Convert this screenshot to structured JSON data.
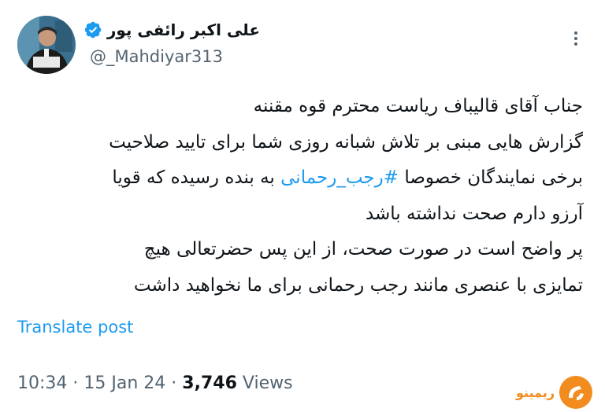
{
  "author": {
    "name": "علی اکبر رائفی پور",
    "handle": "@_Mahdiyar313"
  },
  "post": {
    "lines": [
      {
        "text": "جناب آقای قالیباف ریاست محترم قوه مقننه"
      },
      {
        "text": "گزارش هایی مبنی بر تلاش شبانه روزی شما برای تایید صلاحیت"
      },
      {
        "before": "برخی نمایندگان خصوصا ",
        "hashtag": "#رجب_رحمانی",
        "after": " به بنده رسیده که قویا"
      },
      {
        "text": "آرزو دارم صحت نداشته باشد"
      },
      {
        "text": "پر واضح است در صورت صحت، از این پس حضرتعالی هیچ"
      },
      {
        "text": "تمایزی با عنصری مانند رجب رحمانی برای ما نخواهید داشت"
      }
    ],
    "translate_label": "Translate post"
  },
  "meta": {
    "time": "10:34",
    "date": "15 Jan 24",
    "views_count": "3,746",
    "views_label": "Views",
    "separator": "·"
  },
  "watermark": {
    "text": "ریمینو"
  },
  "colors": {
    "link": "#1d9bf0",
    "secondary": "#536471",
    "primary": "#0f1419",
    "verified": "#1d9bf0",
    "watermark": "#f28c1e"
  },
  "icons": {
    "more": "more-horizontal-icon",
    "verified": "verified-badge-icon"
  }
}
